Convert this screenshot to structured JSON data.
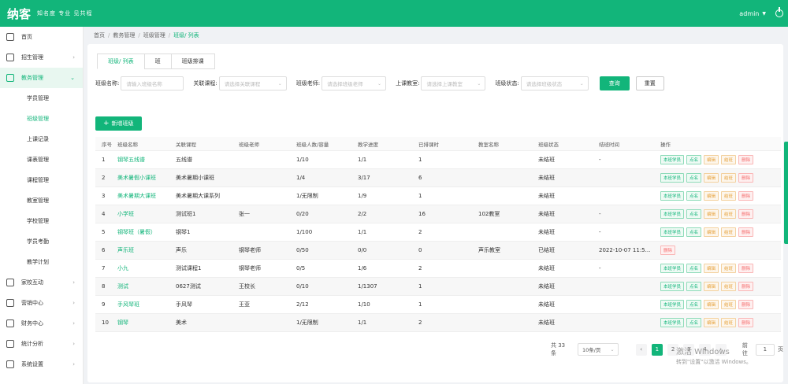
{
  "header": {
    "logo": "纳客",
    "slogan": "知名度 专业 见共程",
    "user": "admin"
  },
  "sidebar": {
    "items": [
      {
        "label": "首页",
        "icon": "home-icon"
      },
      {
        "label": "招生管理",
        "icon": "user-icon"
      },
      {
        "label": "教务管理",
        "icon": "calendar-icon"
      }
    ],
    "subitems": [
      {
        "label": "学员管理"
      },
      {
        "label": "班级管理"
      },
      {
        "label": "上课记录"
      },
      {
        "label": "课表管理"
      },
      {
        "label": "课程管理"
      },
      {
        "label": "教室管理"
      },
      {
        "label": "学校管理"
      },
      {
        "label": "学员考勤"
      },
      {
        "label": "教学计划"
      }
    ],
    "bottom": [
      {
        "label": "家校互动",
        "icon": "chat-icon"
      },
      {
        "label": "营销中心",
        "icon": "gift-icon"
      },
      {
        "label": "财务中心",
        "icon": "wallet-icon"
      },
      {
        "label": "统计分析",
        "icon": "chart-icon"
      },
      {
        "label": "系统设置",
        "icon": "gear-icon"
      }
    ]
  },
  "breadcrumb": [
    "首页",
    "教务管理",
    "班级管理",
    "班级/ 列表"
  ],
  "tabs": [
    "班级/ 列表",
    "班",
    "班级排课"
  ],
  "filters": [
    {
      "label": "班级名称:",
      "placeholder": "请输入班级名称"
    },
    {
      "label": "关联课程:",
      "placeholder": "请选择关联课程"
    },
    {
      "label": "班级老师:",
      "placeholder": "请选择班级老师"
    },
    {
      "label": "上课教室:",
      "placeholder": "请选择上课教室"
    },
    {
      "label": "班级状态:",
      "placeholder": "请选择班级状态"
    }
  ],
  "search_label": "查询",
  "reset_label": "重置",
  "add_label": "新增班级",
  "table": {
    "headers": [
      "序号",
      "班级名称",
      "关联课程",
      "班级老师",
      "班级人数/容量",
      "教学进度",
      "已排课时",
      "教室名称",
      "班级状态",
      "结班时间",
      "操作"
    ],
    "rows": [
      [
        "1",
        "钢琴五线谱",
        "五线谱",
        "",
        "1/10",
        "1/1",
        "1",
        "",
        "未结班",
        "-"
      ],
      [
        "2",
        "美术暑假小课班",
        "美术暑期小课班",
        "",
        "1/4",
        "3/17",
        "6",
        "",
        "未结班",
        ""
      ],
      [
        "3",
        "美术暑期大课班",
        "美术暑期大课系列",
        "",
        "1/无限制",
        "1/9",
        "1",
        "",
        "未结班",
        ""
      ],
      [
        "4",
        "小学班",
        "测试班1",
        "张一",
        "0/20",
        "2/2",
        "16",
        "102教室",
        "未结班",
        "-"
      ],
      [
        "5",
        "钢琴班（暑假）",
        "钢琴1",
        "",
        "1/100",
        "1/1",
        "2",
        "",
        "未结班",
        "-"
      ],
      [
        "6",
        "声乐班",
        "声乐",
        "钢琴老师",
        "0/50",
        "0/0",
        "0",
        "声乐教室",
        "已结班",
        "2022-10-07 11:5..."
      ],
      [
        "7",
        "小九",
        "测试课程1",
        "钢琴老师",
        "0/5",
        "1/6",
        "2",
        "",
        "未结班",
        "-"
      ],
      [
        "8",
        "测试",
        "0627测试",
        "王校长",
        "0/10",
        "1/1307",
        "1",
        "",
        "未结班",
        ""
      ],
      [
        "9",
        "手风琴班",
        "手风琴",
        "王亚",
        "2/12",
        "1/10",
        "1",
        "",
        "未结班",
        ""
      ],
      [
        "10",
        "钢琴",
        "美术",
        "",
        "1/无限制",
        "1/1",
        "2",
        "",
        "未结班",
        ""
      ]
    ],
    "ops": [
      "本班学员",
      "点名",
      "编辑",
      "结班",
      "删除"
    ],
    "ops_closed": [
      "删除"
    ]
  },
  "pagination": {
    "total": "共 33 条",
    "page_size": "10条/页",
    "pages": [
      "1",
      "2",
      "3",
      "4"
    ],
    "goto_prefix": "前往",
    "goto_value": "1",
    "goto_suffix": "页"
  },
  "watermark": {
    "line1": "激活 Windows",
    "line2": "转到\"设置\"以激活 Windows。"
  },
  "colors": {
    "brand": "#12b57a",
    "warning": "#e6a23c",
    "danger": "#f56c6c"
  }
}
